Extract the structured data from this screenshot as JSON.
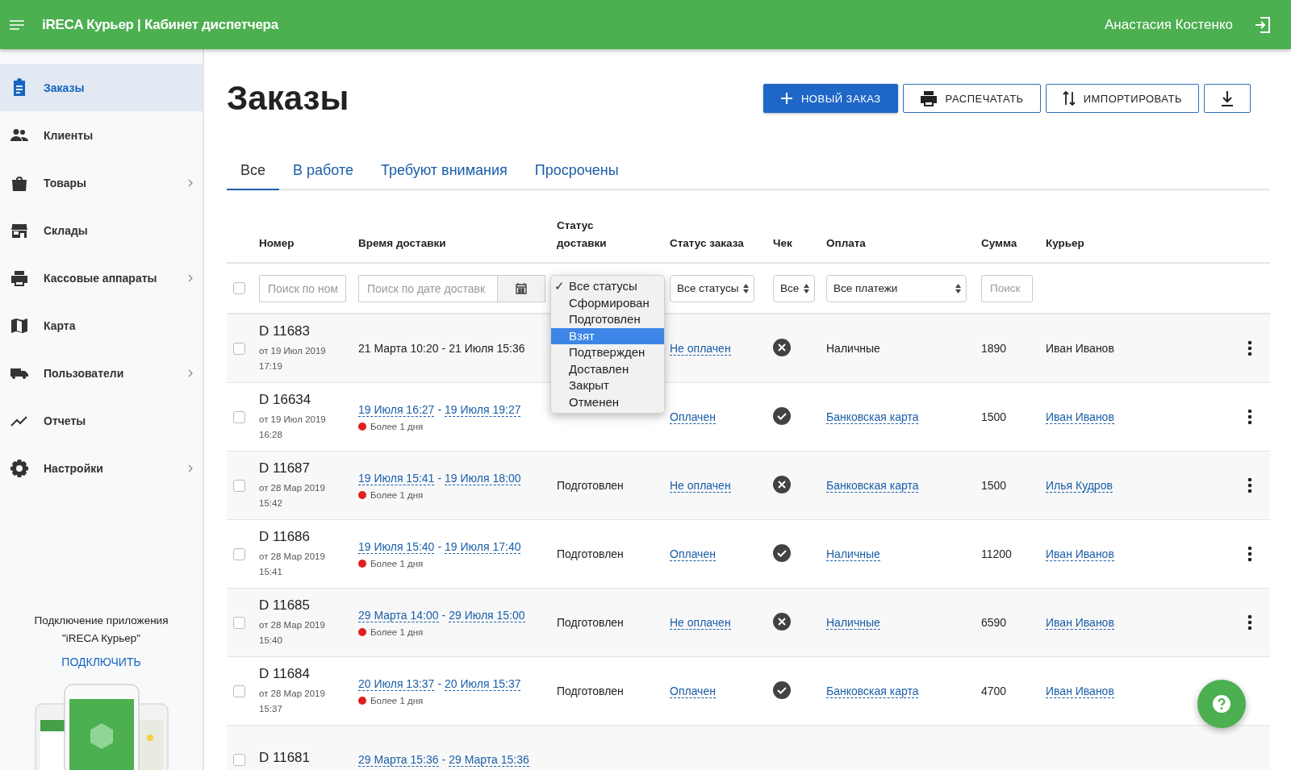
{
  "app_bar": {
    "title": "iRECA Курьер | Кабинет диспетчера",
    "user": "Анастасия Костенко"
  },
  "sidebar": {
    "items": [
      {
        "label": "Заказы",
        "selected": true,
        "has_submenu": false
      },
      {
        "label": "Клиенты",
        "selected": false,
        "has_submenu": false
      },
      {
        "label": "Товары",
        "selected": false,
        "has_submenu": true
      },
      {
        "label": "Склады",
        "selected": false,
        "has_submenu": false
      },
      {
        "label": "Кассовые аппараты",
        "selected": false,
        "has_submenu": true
      },
      {
        "label": "Карта",
        "selected": false,
        "has_submenu": false
      },
      {
        "label": "Пользователи",
        "selected": false,
        "has_submenu": true
      },
      {
        "label": "Отчеты",
        "selected": false,
        "has_submenu": false
      },
      {
        "label": "Настройки",
        "selected": false,
        "has_submenu": true
      }
    ],
    "connect": {
      "text": "Подключение приложения \"iRECA Курьер\"",
      "link": "ПОДКЛЮЧИТЬ",
      "kind": "picture"
    }
  },
  "page_title": "Заказы",
  "actions": [
    {
      "label": "НОВЫЙ ЗАКАЗ",
      "primary": true
    },
    {
      "label": "РАСПЕЧАТАТЬ",
      "primary": false
    },
    {
      "label": "ИМПОРТИРОВАТЬ",
      "primary": false
    },
    {
      "primary": false
    }
  ],
  "tabs": [
    {
      "label": "Все",
      "selected": true
    },
    {
      "label": "В работе",
      "selected": false
    },
    {
      "label": "Требуют внимания",
      "selected": false
    },
    {
      "label": "Просрочены",
      "selected": false
    }
  ],
  "table": {
    "columns": [
      "Номер",
      "Время доставки",
      "Статус доставки",
      "Статус заказа",
      "Чек",
      "Оплата",
      "Сумма",
      "Курьер"
    ],
    "filters": {
      "all_checked": false,
      "number_placeholder": "Поиск по ном",
      "date_placeholder": "Поиск по дате доставк",
      "order_status": "Все статусы",
      "check": "Все",
      "payment": "Все платежи",
      "sum_placeholder": "Поиск",
      "check_mark": "✓",
      "delivery_options": [
        {
          "label": "Все статусы",
          "checked": true,
          "selected": false
        },
        {
          "label": "Сформирован",
          "checked": false,
          "selected": false
        },
        {
          "label": "Подготовлен",
          "checked": false,
          "selected": false
        },
        {
          "label": "Взят",
          "checked": false,
          "selected": true
        },
        {
          "label": "Подтвержден",
          "checked": false,
          "selected": false
        },
        {
          "label": "Доставлен",
          "checked": false,
          "selected": false
        },
        {
          "label": "Закрыт",
          "checked": false,
          "selected": false
        },
        {
          "label": "Отменен",
          "checked": false,
          "selected": false
        }
      ]
    },
    "rows": [
      {
        "number": "D 11683",
        "created": "от 19 Июл 2019",
        "created_time": "17:19",
        "from": "21 Марта 10:20",
        "separator": "-",
        "to": "21 Июля 15:36",
        "linked": false,
        "order": "Не оплачен",
        "receipt": false,
        "payment": "Наличные",
        "sum": "1890",
        "courier": "Иван Иванов",
        "checked": false
      },
      {
        "number": "D 16634",
        "created": "от 19 Июл 2019",
        "created_time": "16:28",
        "from": "19 Июля 16:27",
        "separator": "-",
        "to": "19 Июля 19:27",
        "linked": true,
        "overdue": "Более 1 дня",
        "order": "Оплачен",
        "receipt": true,
        "payment": "Банковская карта",
        "sum": "1500",
        "courier": "Иван Иванов",
        "checked": false
      },
      {
        "number": "D 11687",
        "created": "от 28 Мар 2019",
        "created_time": "15:42",
        "from": "19 Июля 15:41",
        "separator": "-",
        "to": "19 Июля 18:00",
        "linked": true,
        "overdue": "Более 1 дня",
        "delivery": "Подготовлен",
        "order": "Не оплачен",
        "receipt": false,
        "payment": "Банковская карта",
        "sum": "1500",
        "courier": "Илья Кудров",
        "checked": false
      },
      {
        "number": "D 11686",
        "created": "от 28 Мар 2019",
        "created_time": "15:41",
        "from": "19 Июля 15:40",
        "separator": "-",
        "to": "19 Июля 17:40",
        "linked": true,
        "overdue": "Более 1 дня",
        "delivery": "Подготовлен",
        "order": "Оплачен",
        "receipt": true,
        "payment": "Наличные",
        "sum": "11200",
        "courier": "Иван Иванов",
        "checked": false
      },
      {
        "number": "D 11685",
        "created": "от 28 Мар 2019",
        "created_time": "15:40",
        "from": "29 Марта 14:00",
        "separator": "-",
        "to": "29 Июля 15:00",
        "linked": true,
        "overdue": "Более 1 дня",
        "delivery": "Подготовлен",
        "order": "Не оплачен",
        "receipt": false,
        "payment": "Наличные",
        "sum": "6590",
        "courier": "Иван Иванов",
        "checked": false
      },
      {
        "number": "D 11684",
        "created": "от 28 Мар 2019",
        "created_time": "15:37",
        "from": "20 Июля 13:37",
        "separator": "-",
        "to": "20 Июля 15:37",
        "linked": true,
        "overdue": "Более 1 дня",
        "delivery": "Подготовлен",
        "order": "Оплачен",
        "receipt": true,
        "payment": "Банковская карта",
        "sum": "4700",
        "courier": "Иван Иванов",
        "checked": false
      },
      {
        "number": "D 11681",
        "from": "29 Марта 15:36",
        "separator": "-",
        "to": "29 Марта 15:36",
        "linked": true,
        "checked": false
      }
    ]
  }
}
